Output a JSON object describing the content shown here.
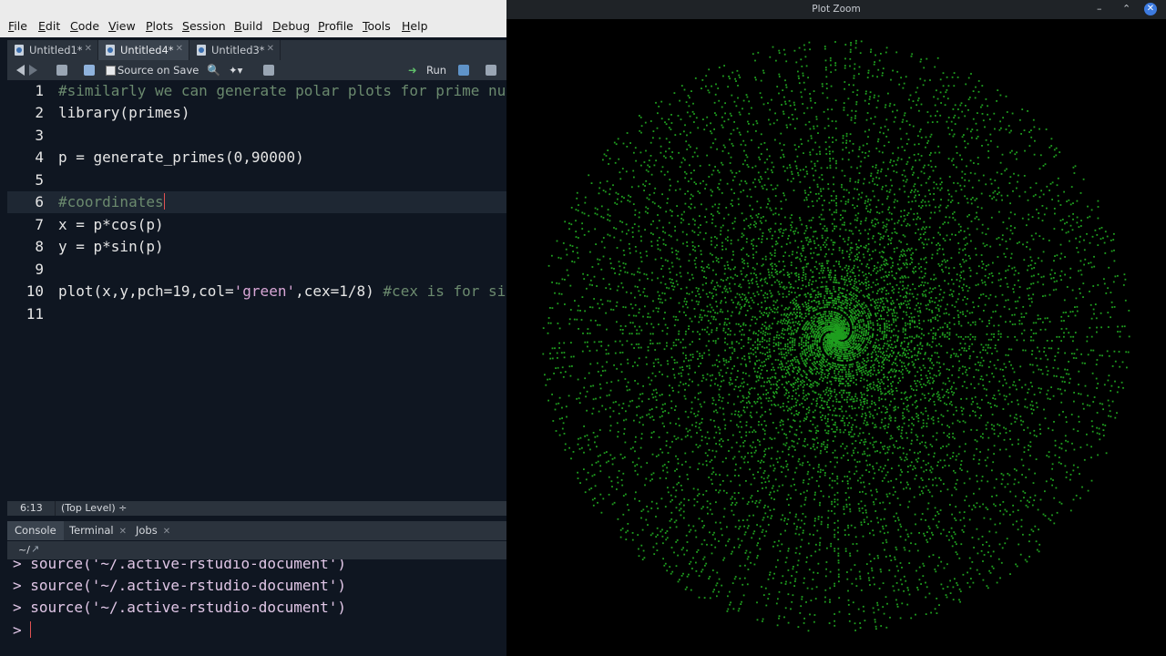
{
  "menu": [
    "File",
    "Edit",
    "Code",
    "View",
    "Plots",
    "Session",
    "Build",
    "Debug",
    "Profile",
    "Tools",
    "Help"
  ],
  "menu_underline": [
    "F",
    "E",
    "C",
    "V",
    "P",
    "S",
    "B",
    "D",
    "P",
    "T",
    "H"
  ],
  "tabs": [
    {
      "label": "Untitled1*"
    },
    {
      "label": "Untitled4*"
    },
    {
      "label": "Untitled3*"
    }
  ],
  "toolbar": {
    "source_on_save": "Source on Save",
    "run": "Run"
  },
  "code_lines": [
    {
      "n": "1",
      "text": "#similarly we can generate polar plots for prime numbers"
    },
    {
      "n": "2",
      "text": "library(primes)"
    },
    {
      "n": "3",
      "text": ""
    },
    {
      "n": "4",
      "text": "p = generate_primes(0,90000)"
    },
    {
      "n": "5",
      "text": ""
    },
    {
      "n": "6",
      "text": "#coordinates"
    },
    {
      "n": "7",
      "text": "x = p*cos(p)"
    },
    {
      "n": "8",
      "text": "y = p*sin(p)"
    },
    {
      "n": "9",
      "text": ""
    },
    {
      "n": "10",
      "text": "plot(x,y,pch=19,col=",
      "str": "'green'",
      "rest": ",cex=1/8) ",
      "comment": "#cex is for size"
    },
    {
      "n": "11",
      "text": ""
    }
  ],
  "status": {
    "position": "6:13",
    "scope": "(Top Level) ÷"
  },
  "console_tabs": [
    "Console",
    "Terminal",
    "Jobs"
  ],
  "console_path": "~/",
  "console_lines": [
    "> source('~/.active-rstudio-document')",
    "> source('~/.active-rstudio-document')",
    "> source('~/.active-rstudio-document')",
    ">"
  ],
  "plot_window": {
    "title": "Plot Zoom",
    "minimize": "–",
    "maximize": "⌃",
    "close": "✕"
  },
  "chart_data": {
    "type": "scatter",
    "description_source": "plot(x,y) with x = p*cos(p), y = p*sin(p), p = primes up to 90000",
    "point_color": "#1f9e1f",
    "background": "#000000",
    "r_max": 90000
  }
}
